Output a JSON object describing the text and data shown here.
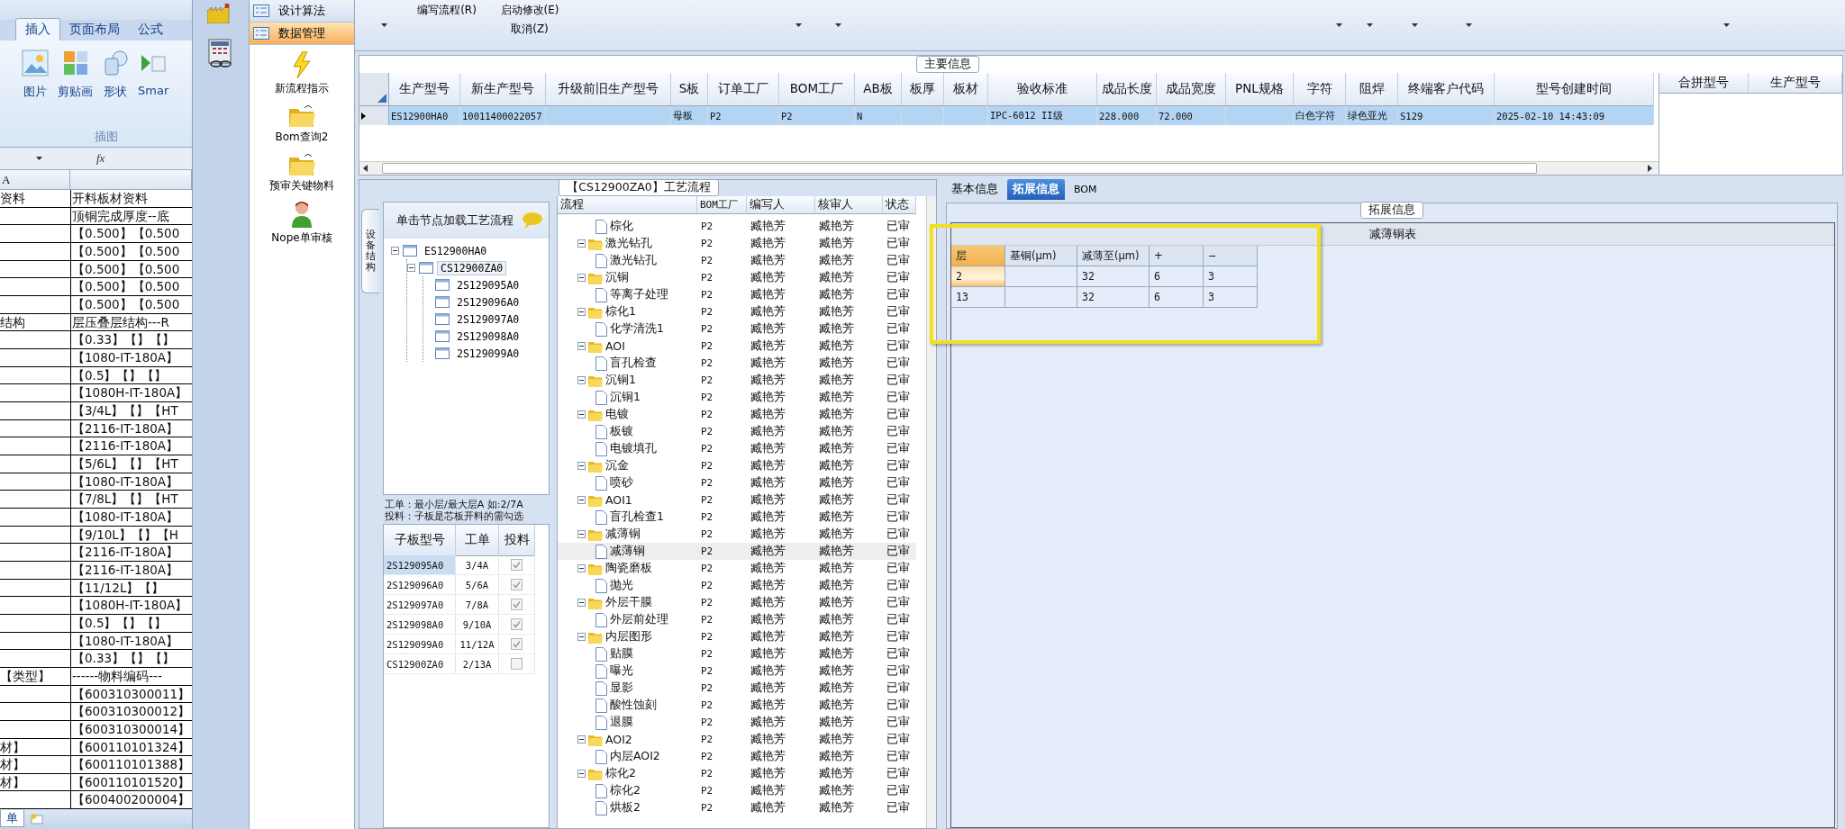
{
  "excel": {
    "ribbon_tabs": [
      {
        "label": "插入",
        "selected": true
      },
      {
        "label": "页面布局",
        "selected": false
      },
      {
        "label": "公式",
        "selected": false
      }
    ],
    "ribbon_buttons": [
      {
        "kind": "picture",
        "label": "图片"
      },
      {
        "kind": "clipart",
        "label": "剪贴画"
      },
      {
        "kind": "shapes",
        "label": "形状"
      },
      {
        "kind": "smartart",
        "label": "Smar"
      }
    ],
    "ribbon_group": "插图",
    "formula_icon": "fx",
    "column_header": "A",
    "rows": [
      {
        "a": "资料",
        "b": "开料板材资料"
      },
      {
        "b": "顶铜完成厚度--底"
      },
      {
        "b": "【0.500】【0.500"
      },
      {
        "b": "【0.500】【0.500"
      },
      {
        "b": "【0.500】【0.500"
      },
      {
        "b": "【0.500】【0.500"
      },
      {
        "b": "【0.500】【0.500"
      },
      {
        "a": "结构",
        "b": "层压叠层结构---R"
      },
      {
        "b": "【0.33】【】【】"
      },
      {
        "b": "【1080-IT-180A】"
      },
      {
        "b": "【0.5】【】【】"
      },
      {
        "b": "【1080H-IT-180A】"
      },
      {
        "b": "【3/4L】【】【HT"
      },
      {
        "b": "【2116-IT-180A】"
      },
      {
        "b": "【2116-IT-180A】"
      },
      {
        "b": "【5/6L】【】【HT"
      },
      {
        "b": "【1080-IT-180A】"
      },
      {
        "b": "【7/8L】【】【HT"
      },
      {
        "b": "【1080-IT-180A】"
      },
      {
        "b": "【9/10L】【】【H"
      },
      {
        "b": "【2116-IT-180A】"
      },
      {
        "b": "【2116-IT-180A】"
      },
      {
        "b": "【11/12L】【】"
      },
      {
        "b": "【1080H-IT-180A】"
      },
      {
        "b": "【0.5】【】【】"
      },
      {
        "b": "【1080-IT-180A】"
      },
      {
        "b": "【0.33】【】【】"
      },
      {
        "a": "【类型】",
        "b": "------物料编码---"
      },
      {
        "b": "【600310300011】"
      },
      {
        "b": "【600310300012】"
      },
      {
        "b": "【600310300014】"
      },
      {
        "a": "材】",
        "b": "【600110101324】"
      },
      {
        "a": "材】",
        "b": "【600110101388】"
      },
      {
        "a": "材】",
        "b": "【600110101520】"
      },
      {
        "b": "【600400200004】"
      }
    ],
    "sheet_tab": "单"
  },
  "sidebar": {
    "items": [
      {
        "label": "设计算法",
        "selected": false
      },
      {
        "label": "数据管理",
        "selected": true
      }
    ],
    "tools": [
      {
        "kind": "flash",
        "label": "新流程指示"
      },
      {
        "kind": "folder",
        "label": "Bom查询2"
      },
      {
        "kind": "folder",
        "label": "预审关键物料"
      },
      {
        "kind": "person",
        "label": "Nope单审核"
      }
    ]
  },
  "toolbar": {
    "buttons": [
      {
        "label": "编写流程(R)"
      },
      {
        "label": "启动修改(E)"
      },
      {
        "label": "取消(Z)"
      }
    ]
  },
  "main_info": {
    "title": "主要信息",
    "columns": [
      "生产型号",
      "新生产型号",
      "升级前旧生产型号",
      "S板",
      "订单工厂",
      "BOM工厂",
      "AB板",
      "板厚",
      "板材",
      "验收标准",
      "成品长度",
      "成品宽度",
      "PNL规格",
      "字符",
      "阻焊",
      "终端客户代码",
      "型号创建时间"
    ],
    "rows": [
      {
        "selected": true,
        "cells": [
          "ES12900HA0",
          "10011400022057",
          null,
          "母板",
          "P2",
          "P2",
          "N",
          null,
          null,
          "IPC-6012 II级",
          "228.000",
          "72.000",
          null,
          "白色字符",
          "绿色亚光",
          "S129",
          "2025-02-10 14:43:09"
        ]
      }
    ],
    "merge_columns": [
      "合拼型号",
      "生产型号"
    ]
  },
  "flow_panel": {
    "title": "【CS12900ZA0】工艺流程",
    "side_tab": "设备结构",
    "tree_hint": "单击节点加载工艺流程",
    "tree": [
      {
        "label": "ES12900HA0",
        "expanded": true,
        "selected": false,
        "children": [
          {
            "label": "CS12900ZA0",
            "expanded": true,
            "selected": true,
            "children": [
              {
                "label": "2S129095A0",
                "selected": false
              },
              {
                "label": "2S129096A0",
                "selected": false
              },
              {
                "label": "2S129097A0",
                "selected": false
              },
              {
                "label": "2S129098A0",
                "selected": false
              },
              {
                "label": "2S129099A0",
                "selected": false
              }
            ]
          }
        ]
      }
    ],
    "notes": [
      "工单：最小层/最大层A 如:2/7A",
      "投料：子板是芯板开料的需勾选"
    ],
    "sub_grid": {
      "columns": [
        "子板型号",
        "工单",
        "投料"
      ],
      "rows": [
        {
          "model": "2S129095A0",
          "order": "3/4A",
          "checked": true,
          "selected": true
        },
        {
          "model": "2S129096A0",
          "order": "5/6A",
          "checked": true,
          "selected": false
        },
        {
          "model": "2S129097A0",
          "order": "7/8A",
          "checked": true,
          "selected": false
        },
        {
          "model": "2S129098A0",
          "order": "9/10A",
          "checked": true,
          "selected": false
        },
        {
          "model": "2S129099A0",
          "order": "11/12A",
          "checked": true,
          "selected": false
        },
        {
          "model": "CS12900ZA0",
          "order": "2/13A",
          "checked": false,
          "selected": false
        }
      ]
    },
    "process_grid": {
      "columns": [
        "流程",
        "BOM工厂",
        "编写人",
        "核审人",
        "状态"
      ],
      "groups": [
        {
          "children": [
            {
              "name": "棕化",
              "bom": "P2",
              "writer": "臧艳芳",
              "reviewer": "臧艳芳",
              "status": "已审",
              "selected": false
            }
          ]
        },
        {
          "name": "激光钻孔",
          "bom": "P2",
          "writer": "臧艳芳",
          "reviewer": "臧艳芳",
          "status": "已审",
          "selected": false,
          "children": [
            {
              "name": "激光钻孔",
              "bom": "P2",
              "writer": "臧艳芳",
              "reviewer": "臧艳芳",
              "status": "已审",
              "selected": false
            }
          ]
        },
        {
          "name": "沉铜",
          "bom": "P2",
          "writer": "臧艳芳",
          "reviewer": "臧艳芳",
          "status": "已审",
          "selected": false,
          "children": [
            {
              "name": "等离子处理",
              "bom": "P2",
              "writer": "臧艳芳",
              "reviewer": "臧艳芳",
              "status": "已审",
              "selected": false
            }
          ]
        },
        {
          "name": "棕化1",
          "bom": "P2",
          "writer": "臧艳芳",
          "reviewer": "臧艳芳",
          "status": "已审",
          "selected": false,
          "children": [
            {
              "name": "化学清洗1",
              "bom": "P2",
              "writer": "臧艳芳",
              "reviewer": "臧艳芳",
              "status": "已审",
              "selected": false
            }
          ]
        },
        {
          "name": "AOI",
          "bom": "P2",
          "writer": "臧艳芳",
          "reviewer": "臧艳芳",
          "status": "已审",
          "selected": false,
          "children": [
            {
              "name": "盲孔检查",
              "bom": "P2",
              "writer": "臧艳芳",
              "reviewer": "臧艳芳",
              "status": "已审",
              "selected": false
            }
          ]
        },
        {
          "name": "沉铜1",
          "bom": "P2",
          "writer": "臧艳芳",
          "reviewer": "臧艳芳",
          "status": "已审",
          "selected": false,
          "children": [
            {
              "name": "沉铜1",
              "bom": "P2",
              "writer": "臧艳芳",
              "reviewer": "臧艳芳",
              "status": "已审",
              "selected": false
            }
          ]
        },
        {
          "name": "电镀",
          "bom": "P2",
          "writer": "臧艳芳",
          "reviewer": "臧艳芳",
          "status": "已审",
          "selected": false,
          "children": [
            {
              "name": "板镀",
              "bom": "P2",
              "writer": "臧艳芳",
              "reviewer": "臧艳芳",
              "status": "已审",
              "selected": false
            },
            {
              "name": "电镀填孔",
              "bom": "P2",
              "writer": "臧艳芳",
              "reviewer": "臧艳芳",
              "status": "已审",
              "selected": false
            }
          ]
        },
        {
          "name": "沉金",
          "bom": "P2",
          "writer": "臧艳芳",
          "reviewer": "臧艳芳",
          "status": "已审",
          "selected": false,
          "children": [
            {
              "name": "喷砂",
              "bom": "P2",
              "writer": "臧艳芳",
              "reviewer": "臧艳芳",
              "status": "已审",
              "selected": false
            }
          ]
        },
        {
          "name": "AOI1",
          "bom": "P2",
          "writer": "臧艳芳",
          "reviewer": "臧艳芳",
          "status": "已审",
          "selected": false,
          "children": [
            {
              "name": "盲孔检查1",
              "bom": "P2",
              "writer": "臧艳芳",
              "reviewer": "臧艳芳",
              "status": "已审",
              "selected": false
            }
          ]
        },
        {
          "name": "减薄铜",
          "bom": "P2",
          "writer": "臧艳芳",
          "reviewer": "臧艳芳",
          "status": "已审",
          "selected": false,
          "children": [
            {
              "name": "减薄铜",
              "bom": "P2",
              "writer": "臧艳芳",
              "reviewer": "臧艳芳",
              "status": "已审",
              "selected": true
            }
          ]
        },
        {
          "name": "陶瓷磨板",
          "bom": "P2",
          "writer": "臧艳芳",
          "reviewer": "臧艳芳",
          "status": "已审",
          "selected": false,
          "children": [
            {
              "name": "抛光",
              "bom": "P2",
              "writer": "臧艳芳",
              "reviewer": "臧艳芳",
              "status": "已审",
              "selected": false
            }
          ]
        },
        {
          "name": "外层干膜",
          "bom": "P2",
          "writer": "臧艳芳",
          "reviewer": "臧艳芳",
          "status": "已审",
          "selected": false,
          "children": [
            {
              "name": "外层前处理",
              "bom": "P2",
              "writer": "臧艳芳",
              "reviewer": "臧艳芳",
              "status": "已审",
              "selected": false
            }
          ]
        },
        {
          "name": "内层图形",
          "bom": "P2",
          "writer": "臧艳芳",
          "reviewer": "臧艳芳",
          "status": "已审",
          "selected": false,
          "children": [
            {
              "name": "贴膜",
              "bom": "P2",
              "writer": "臧艳芳",
              "reviewer": "臧艳芳",
              "status": "已审",
              "selected": false
            },
            {
              "name": "曝光",
              "bom": "P2",
              "writer": "臧艳芳",
              "reviewer": "臧艳芳",
              "status": "已审",
              "selected": false
            },
            {
              "name": "显影",
              "bom": "P2",
              "writer": "臧艳芳",
              "reviewer": "臧艳芳",
              "status": "已审",
              "selected": false
            },
            {
              "name": "酸性蚀刻",
              "bom": "P2",
              "writer": "臧艳芳",
              "reviewer": "臧艳芳",
              "status": "已审",
              "selected": false
            },
            {
              "name": "退膜",
              "bom": "P2",
              "writer": "臧艳芳",
              "reviewer": "臧艳芳",
              "status": "已审",
              "selected": false
            }
          ]
        },
        {
          "name": "AOI2",
          "bom": "P2",
          "writer": "臧艳芳",
          "reviewer": "臧艳芳",
          "status": "已审",
          "selected": false,
          "children": [
            {
              "name": "内层AOI2",
              "bom": "P2",
              "writer": "臧艳芳",
              "reviewer": "臧艳芳",
              "status": "已审",
              "selected": false
            }
          ]
        },
        {
          "name": "棕化2",
          "bom": "P2",
          "writer": "臧艳芳",
          "reviewer": "臧艳芳",
          "status": "已审",
          "selected": false,
          "children": [
            {
              "name": "棕化2",
              "bom": "P2",
              "writer": "臧艳芳",
              "reviewer": "臧艳芳",
              "status": "已审",
              "selected": false
            },
            {
              "name": "烘板2",
              "bom": "P2",
              "writer": "臧艳芳",
              "reviewer": "臧艳芳",
              "status": "已审",
              "selected": false
            }
          ]
        }
      ]
    }
  },
  "detail": {
    "tabs": [
      {
        "label": "基本信息",
        "selected": false
      },
      {
        "label": "拓展信息",
        "selected": true
      },
      {
        "label": "BOM",
        "selected": false
      }
    ],
    "group_title": "拓展信息",
    "table_title": "减薄铜表",
    "columns": [
      {
        "label": "层",
        "current": true
      },
      {
        "label": "基铜(μm)",
        "current": false
      },
      {
        "label": "减薄至(μm)",
        "current": false
      },
      {
        "label": "+",
        "current": false
      },
      {
        "label": "−",
        "current": false
      }
    ],
    "rows": [
      {
        "current": true,
        "cells": [
          "2",
          null,
          "32",
          "6",
          "3"
        ]
      },
      {
        "current": false,
        "cells": [
          "13",
          null,
          "32",
          "6",
          "3"
        ]
      }
    ]
  }
}
